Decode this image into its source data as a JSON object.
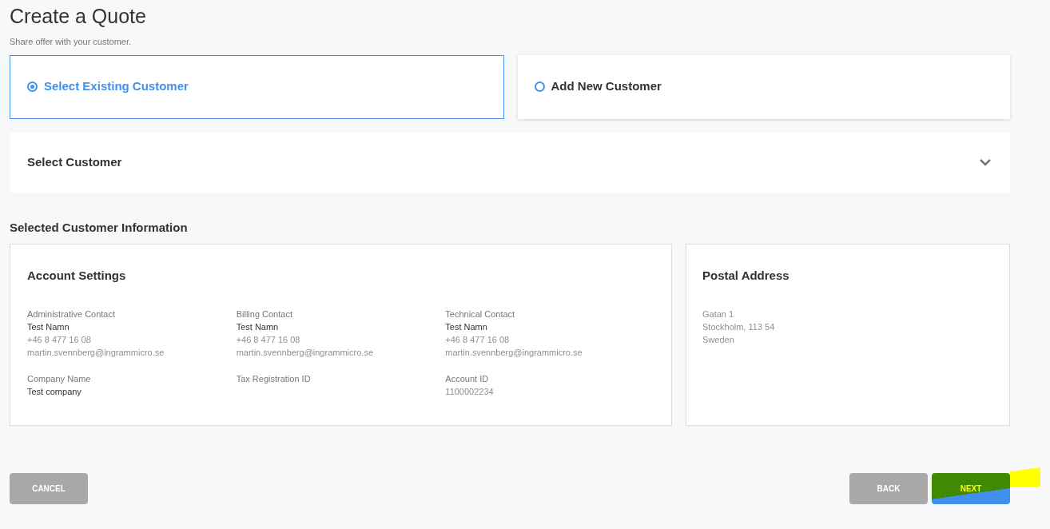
{
  "title": "Create a Quote",
  "subtitle": "Share offer with your customer.",
  "customer_options": [
    {
      "label": "Select Existing Customer",
      "selected": true
    },
    {
      "label": "Add New Customer",
      "selected": false
    }
  ],
  "select_customer": {
    "label": "Select Customer",
    "expanded": false
  },
  "section_title": "Selected Customer Information",
  "account_settings": {
    "title": "Account Settings",
    "fields": [
      {
        "label": "Administrative Contact",
        "lines": [
          {
            "text": "Test Namn",
            "faded": false
          },
          {
            "text": "+46 8 477 16 08",
            "faded": true
          },
          {
            "text": "martin.svennberg@ingrammicro.se",
            "faded": true
          }
        ]
      },
      {
        "label": "Billing Contact",
        "lines": [
          {
            "text": "Test Namn",
            "faded": false
          },
          {
            "text": "+46 8 477 16 08",
            "faded": true
          },
          {
            "text": "martin.svennberg@ingrammicro.se",
            "faded": true
          }
        ]
      },
      {
        "label": "Technical Contact",
        "lines": [
          {
            "text": "Test Namn",
            "faded": false
          },
          {
            "text": "+46 8 477 16 08",
            "faded": true
          },
          {
            "text": "martin.svennberg@ingrammicro.se",
            "faded": true
          }
        ]
      },
      {
        "label": "Company Name",
        "lines": [
          {
            "text": "Test company",
            "faded": false
          }
        ]
      },
      {
        "label": "Tax Registration ID"
      },
      {
        "label": "Account ID",
        "lines": [
          {
            "text": "1100002234",
            "faded": true
          }
        ]
      }
    ]
  },
  "postal_address": {
    "title": "Postal Address",
    "lines": [
      {
        "text": "Gatan 1",
        "faded": true
      },
      {
        "text": "Stockholm, 113 54",
        "faded": true
      },
      {
        "text": "Sweden",
        "faded": true
      }
    ]
  },
  "buttons": [
    {
      "label": "CANCEL",
      "kind": "secondary"
    },
    {
      "label": "BACK",
      "kind": "secondary"
    },
    {
      "label": "NEXT",
      "kind": "primary"
    }
  ]
}
